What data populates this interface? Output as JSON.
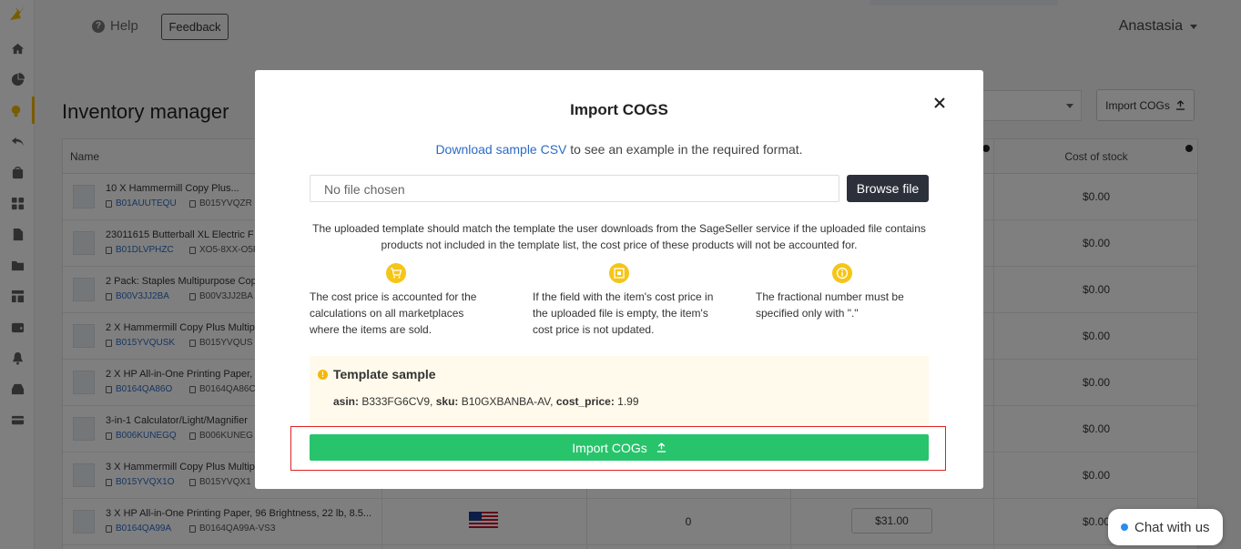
{
  "header": {
    "help_label": "Help",
    "feedback_label": "Feedback",
    "user_name": "Anastasia"
  },
  "page": {
    "title": "Inventory manager",
    "import_button_label": "Import COGs"
  },
  "table": {
    "columns": {
      "name": "Name",
      "cost_of_stock": "Cost of stock"
    },
    "rows": [
      {
        "name": "10 X Hammermill Copy Plus...",
        "asin": "B01AUUTEQU",
        "sku": "B015YVQZR",
        "cost": "$0.00"
      },
      {
        "name": "23011615 Butterball XL Electric F",
        "asin": "B01DLVPHZC",
        "sku": "XO5-8XX-O5P",
        "cost": "$0.00"
      },
      {
        "name": "2 Pack: Staples Multipurpose Cop",
        "asin": "B00V3JJ2BA",
        "sku": "B00V3JJ2BA",
        "cost": "$0.00"
      },
      {
        "name": "2 X Hammermill Copy Plus Multip",
        "asin": "B015YVQUSK",
        "sku": "B015YVQUS",
        "cost": "$0.00"
      },
      {
        "name": "2 X HP All-in-One Printing Paper,",
        "asin": "B0164QA86O",
        "sku": "B0164QA86C",
        "cost": "$0.00"
      },
      {
        "name": "3-in-1 Calculator/Light/Magnifier",
        "asin": "B006KUNEGQ",
        "sku": "B006KUNEG",
        "cost": "$0.00"
      },
      {
        "name": "3 X Hammermill Copy Plus Multip",
        "asin": "B015YVQX1O",
        "sku": "B015YVQX1",
        "cost": "$0.00"
      },
      {
        "name": "3 X HP All-in-One Printing Paper, 96 Brightness, 22 lb, 8.5...",
        "asin": "B0164QA99A",
        "sku": "B0164QA99A-VS3",
        "cost": "$0.00",
        "qty": "0",
        "price": "$31.00"
      }
    ]
  },
  "modal": {
    "title": "Import COGS",
    "download_link": "Download sample CSV",
    "subtitle_rest": " to see an example in the required format.",
    "file_placeholder": "No file chosen",
    "browse_label": "Browse file",
    "note": "The uploaded template should match the template the user downloads from the SageSeller service if the uploaded file contains products not included in the template list, the cost price of these products will not be accounted for.",
    "features": [
      {
        "icon": "cart-icon",
        "text": "The cost price is accounted for the calculations on all marketplaces where the items are sold."
      },
      {
        "icon": "square-icon",
        "text": "If the field with the item's cost price in the uploaded file is empty, the item's cost price is not updated."
      },
      {
        "icon": "info-icon",
        "text": "The fractional number must be specified only with \".\""
      }
    ],
    "template": {
      "heading": "Template sample",
      "asin_key": "asin:",
      "asin_val": " B333FG6CV9, ",
      "sku_key": "sku:",
      "sku_val": " B10GXBANBA-AV, ",
      "price_key": "cost_price:",
      "price_val": " 1.99"
    },
    "import_label": "Import COGs"
  },
  "chat": {
    "label": "Chat with us"
  },
  "colors": {
    "accent": "#f5b800",
    "import_green": "#27c46b",
    "link_blue": "#2c6bc5",
    "highlight_red": "#dd2222"
  }
}
